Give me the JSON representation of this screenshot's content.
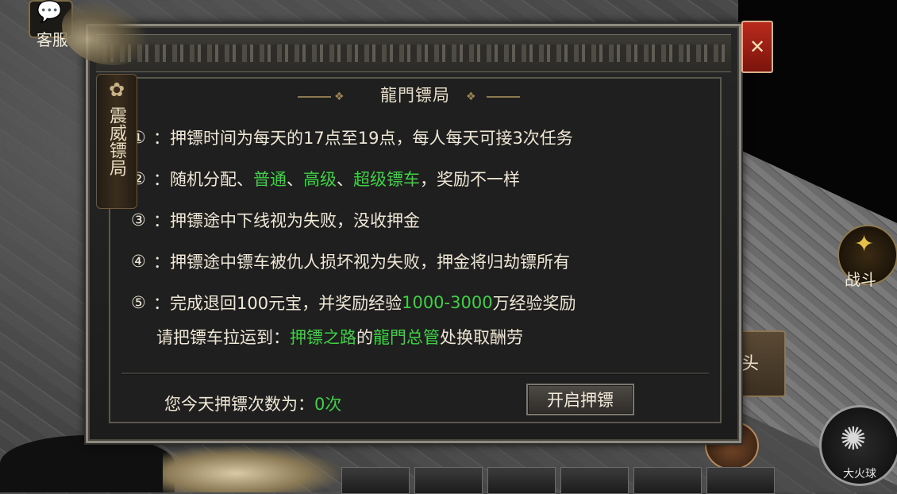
{
  "background": {
    "customer_service_label": "客服",
    "fight_label": "战斗",
    "side_button_label": "头",
    "skill_label": "大火球"
  },
  "dialog": {
    "title": "龍門镖局",
    "side_tab_text": "震威镖局",
    "close_icon": "✕",
    "rules": [
      {
        "num": "①",
        "parts": [
          {
            "t": "：押镖时间为每天的17点至19点，每人每天可接3次任务",
            "g": false
          }
        ]
      },
      {
        "num": "②",
        "parts": [
          {
            "t": "：随机分配、",
            "g": false
          },
          {
            "t": "普通",
            "g": true
          },
          {
            "t": "、",
            "g": false
          },
          {
            "t": "高级",
            "g": true
          },
          {
            "t": "、",
            "g": false
          },
          {
            "t": "超级镖车",
            "g": true
          },
          {
            "t": "，奖励不一样",
            "g": false
          }
        ]
      },
      {
        "num": "③",
        "parts": [
          {
            "t": "：押镖途中下线视为失败，没收押金",
            "g": false
          }
        ]
      },
      {
        "num": "④",
        "parts": [
          {
            "t": "：押镖途中镖车被仇人损坏视为失败，押金将归劫镖所有",
            "g": false
          }
        ]
      },
      {
        "num": "⑤",
        "parts": [
          {
            "t": "：完成退回100元宝，并奖励经验",
            "g": false
          },
          {
            "t": "1000-3000",
            "g": true
          },
          {
            "t": "万经验奖励",
            "g": false
          }
        ]
      }
    ],
    "deliver": {
      "prefix": "请把镖车拉运到：",
      "location": "押镖之路",
      "connector": "的",
      "npc": "龍門总管",
      "suffix": "处换取酬劳"
    },
    "count_label": "您今天押镖次数为：",
    "count_value": "0次",
    "start_button": "开启押镖"
  },
  "colors": {
    "highlight": "#3fd046",
    "text": "#efe7d6",
    "close_button": "#b82a1c"
  }
}
